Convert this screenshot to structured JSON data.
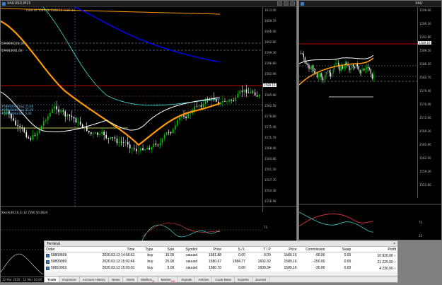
{
  "window_left": {
    "title": "XAUUSD,M15",
    "info_line": "1589.16 1589.26 1588.52 1589.14",
    "lines_labels": [
      "5999999278.16",
      "599910001.00",
      "#59910003 buy 15.00",
      "#59910009 buy 25.00",
      "#59910003 buy 5.00"
    ],
    "price_labels": [
      "1613.00",
      "1609.70",
      "1606.00",
      "1602.80",
      "1599.30",
      "1596.60",
      "1592.90",
      "1589.16",
      "1585.80",
      "1582.50",
      "1578.80",
      "1575.40",
      "1571.70",
      "1568.40",
      "1564.80",
      "1561.30",
      "1557.70",
      "1554.30",
      "1550.90"
    ],
    "ask_label": "1589.16",
    "indicator_label": "Stoch(40,10,2) 32.7290 50.2624",
    "indicator_scale": [
      "75",
      "25"
    ],
    "dates": [
      "12 Mar 2020",
      "12 Mar 16:00",
      "12 Mar 20:00",
      "13 Mar 00:00",
      "13 Mar 04:00",
      "13 Mar 08:00",
      "13 Mar 12:00"
    ]
  },
  "window_right": {
    "title": "XAU",
    "price_labels": [
      "1599.60",
      "1596.20",
      "1592.80",
      "1589.50",
      "1586.10",
      "1582.70",
      "1579.40",
      "1576.00",
      "1572.60",
      "1569.30",
      "1565.90",
      "1562.50",
      "1559.20",
      "1555.80"
    ],
    "ask_label": "1589.16",
    "indicator_scale": [
      "75",
      "25"
    ]
  },
  "terminal": {
    "title": "Terminal",
    "columns": [
      "Order",
      "Time",
      "Type",
      "Size",
      "Symbol",
      "Price",
      "S / L",
      "T / P",
      "Price",
      "Commission",
      "Swap",
      "Profit"
    ],
    "rows": [
      {
        "order": "59809609",
        "time": "2020.03.13 14:56:51",
        "type": "buy",
        "size": "15.00",
        "symbol": "xauusd",
        "price": "1581.88",
        "sl": "0.00",
        "tp": "0.00",
        "cprice": "1589.16",
        "commission": "-90.00",
        "swap": "0.00",
        "profit": "10 920.00"
      },
      {
        "order": "59809989",
        "time": "2020.03.13 15:02:46",
        "type": "buy",
        "size": "25.00",
        "symbol": "xauusd",
        "price": "1580.67",
        "sl": "1584.77",
        "tp": "1602.32",
        "cprice": "1589.16",
        "commission": "-150.00",
        "swap": "0.00",
        "profit": "21 225.00"
      },
      {
        "order": "59810003",
        "time": "2020.03.13 15:03:01",
        "type": "buy",
        "size": "5.00",
        "symbol": "xauusd",
        "price": "1580.70",
        "sl": "0.00",
        "tp": "1600.34",
        "cprice": "1589.16",
        "commission": "-30.00",
        "swap": "0.00",
        "profit": "4 230.00"
      }
    ],
    "tabs": [
      {
        "label": "Trade",
        "badge": ""
      },
      {
        "label": "Exposure",
        "badge": ""
      },
      {
        "label": "Account History",
        "badge": ""
      },
      {
        "label": "News",
        "badge": ""
      },
      {
        "label": "Alerts",
        "badge": ""
      },
      {
        "label": "Mailbox",
        "badge": "11"
      },
      {
        "label": "Market",
        "badge": "110"
      },
      {
        "label": "Signals",
        "badge": ""
      },
      {
        "label": "Articles",
        "badge": ""
      },
      {
        "label": "Code Base",
        "badge": ""
      },
      {
        "label": "Experts",
        "badge": ""
      },
      {
        "label": "Journal",
        "badge": ""
      }
    ]
  },
  "colors": {
    "bull": "#00c800",
    "bear": "#ffffff",
    "ma_fast": "#ffffff",
    "ma_slow": "#ff9900",
    "ma_cyan": "#40e0d0",
    "ma_blue": "#0000ff",
    "ask_line": "#ff0000"
  }
}
